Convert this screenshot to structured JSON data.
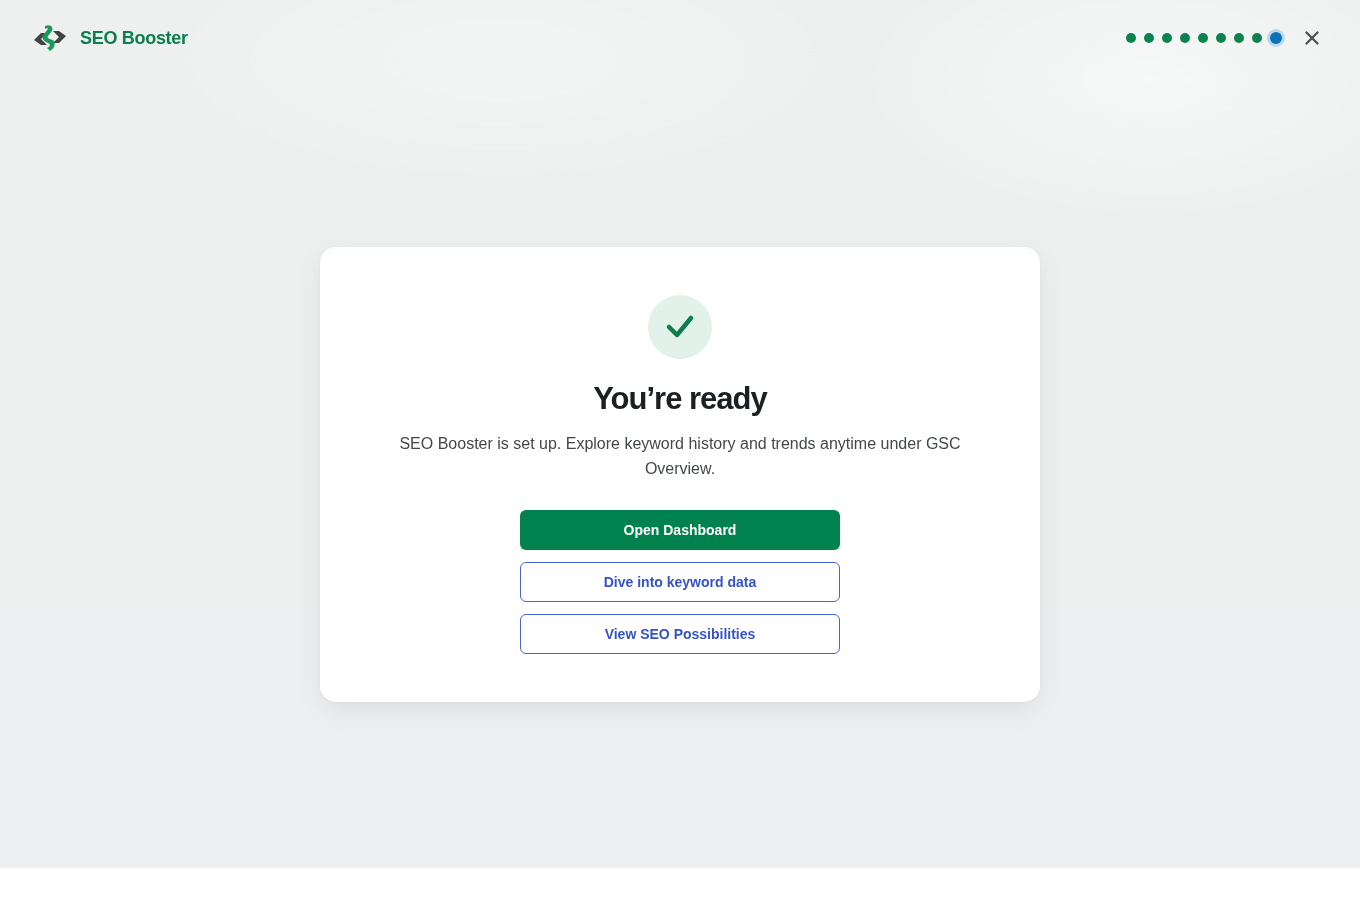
{
  "header": {
    "brand": "SEO Booster",
    "steps": [
      {
        "selected": false
      },
      {
        "selected": false
      },
      {
        "selected": false
      },
      {
        "selected": false
      },
      {
        "selected": false
      },
      {
        "selected": false
      },
      {
        "selected": false
      },
      {
        "selected": false
      },
      {
        "selected": true
      }
    ]
  },
  "card": {
    "title": "You’re ready",
    "message": "SEO Booster is set up. Explore keyword history and trends anytime under GSC Overview.",
    "buttons": [
      {
        "label": "Open Dashboard",
        "kind": "primary"
      },
      {
        "label": "Dive into keyword data",
        "kind": "secondary"
      },
      {
        "label": "View SEO Possibilities",
        "kind": "secondary"
      }
    ]
  }
}
